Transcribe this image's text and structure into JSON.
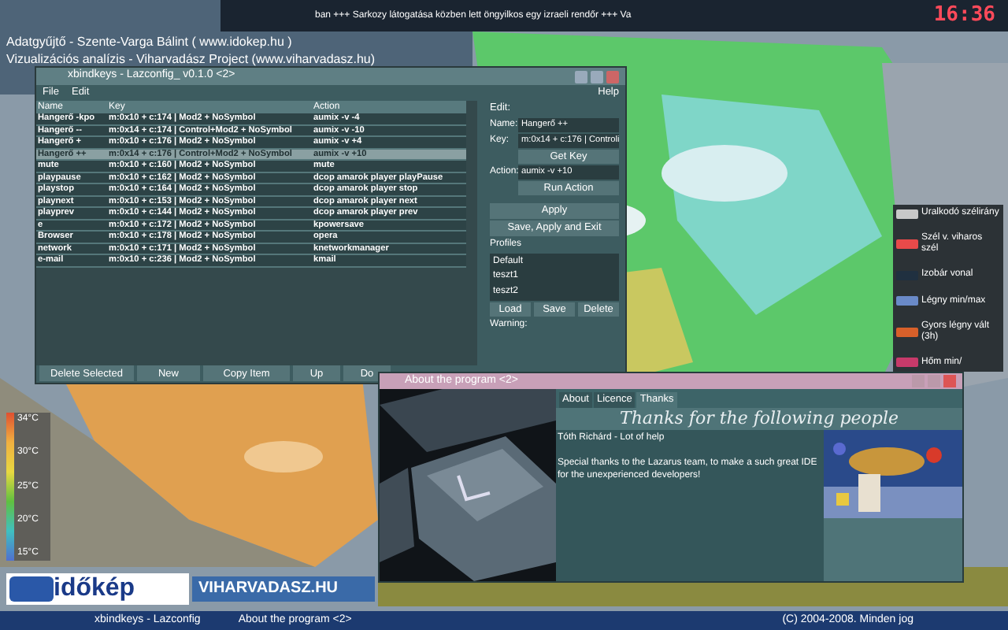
{
  "top_bar": {
    "ticker": "ban +++ Sarkozy látogatása közben lett öngyilkos egy izraeli rendőr +++ Va",
    "clock": "16:36"
  },
  "credits": [
    "Adatgyűjtő - Szente-Varga Bálint ( www.idokep.hu )",
    "Vizualizációs analízis - Viharvadász Project (www.viharvadasz.hu)"
  ],
  "xbindkeys_window": {
    "title": "xbindkeys - Lazconfig_ v0.1.0 <2>",
    "menu": [
      "File",
      "Edit"
    ],
    "help_menu": "Help",
    "columns": [
      "Name",
      "Key",
      "Action"
    ],
    "rows": [
      {
        "name": "Hangerő -kpo",
        "key": "m:0x10 + c:174 | Mod2 + NoSymbol",
        "action": "aumix -v -4",
        "selected": false
      },
      {
        "name": "Hangerő --",
        "key": "m:0x14 + c:174 | Control+Mod2 + NoSymbol",
        "action": "aumix -v -10",
        "selected": false
      },
      {
        "name": "Hangerő +",
        "key": "m:0x10 + c:176 | Mod2 + NoSymbol",
        "action": "aumix -v +4",
        "selected": false
      },
      {
        "name": "Hangerő ++",
        "key": "m:0x14 + c:176 | Control+Mod2 + NoSymbol",
        "action": "aumix -v +10",
        "selected": true
      },
      {
        "name": "mute",
        "key": "m:0x10 + c:160 | Mod2 + NoSymbol",
        "action": "mute",
        "selected": false
      },
      {
        "name": "playpause",
        "key": "m:0x10 + c:162 | Mod2 + NoSymbol",
        "action": "dcop amarok player playPause",
        "selected": false
      },
      {
        "name": "playstop",
        "key": "m:0x10 + c:164 | Mod2 + NoSymbol",
        "action": "dcop amarok player stop",
        "selected": false
      },
      {
        "name": "playnext",
        "key": "m:0x10 + c:153 | Mod2 + NoSymbol",
        "action": "dcop amarok player next",
        "selected": false
      },
      {
        "name": "playprev",
        "key": "m:0x10 + c:144 | Mod2 + NoSymbol",
        "action": "dcop amarok player prev",
        "selected": false
      },
      {
        "name": "e",
        "key": "m:0x10 + c:172 | Mod2 + NoSymbol",
        "action": "kpowersave",
        "selected": false
      },
      {
        "name": "Browser",
        "key": "m:0x10 + c:178 | Mod2 + NoSymbol",
        "action": "opera",
        "selected": false
      },
      {
        "name": "network",
        "key": "m:0x10 + c:171 | Mod2 + NoSymbol",
        "action": "knetworkmanager",
        "selected": false
      },
      {
        "name": "e-mail",
        "key": "m:0x10 + c:236 | Mod2 + NoSymbol",
        "action": "kmail",
        "selected": false
      }
    ],
    "edit": {
      "heading": "Edit:",
      "name_label": "Name:",
      "name_value": "Hangerő ++",
      "key_label": "Key:",
      "key_value": "m:0x14 + c:176 | Controli",
      "get_key": "Get Key",
      "action_label": "Action:",
      "action_value": "aumix -v +10",
      "run_action": "Run Action",
      "apply": "Apply",
      "save_apply_exit": "Save, Apply and Exit",
      "profiles_label": "Profiles",
      "profiles": [
        "Default",
        "teszt1",
        "teszt2"
      ],
      "profile_buttons": [
        "Load",
        "Save",
        "Delete"
      ],
      "warning": "Warning:"
    },
    "bottom_buttons": [
      "Delete Selected",
      "New",
      "Copy Item",
      "Up",
      "Do"
    ]
  },
  "legend": [
    "Uralkodó szélirány",
    "Szél v. viharos szél",
    "Izobár vonal",
    "Légny min/max",
    "Gyors légny vált (3h)",
    "Hőm min/"
  ],
  "temperature_scale": [
    "34°C",
    "30°C",
    "25°C",
    "20°C",
    "15°C"
  ],
  "about_window": {
    "title": "About the program <2>",
    "tabs": [
      {
        "label": "About",
        "selected": false
      },
      {
        "label": "Licence",
        "selected": false
      },
      {
        "label": "Thanks",
        "selected": true
      }
    ],
    "heading": "Thanks for the following people",
    "lines": [
      "Tóth Richárd - Lot of help",
      "Special thanks to the Lazarus team, to make a such great IDE for the unexperienced developers!"
    ]
  },
  "banner": {
    "logo": "időkép",
    "site": "VIHARVADASZ.HU"
  },
  "taskbar": [
    "xbindkeys - Lazconfig",
    "About the program <2>",
    "(C) 2004-2008. Minden jog"
  ]
}
